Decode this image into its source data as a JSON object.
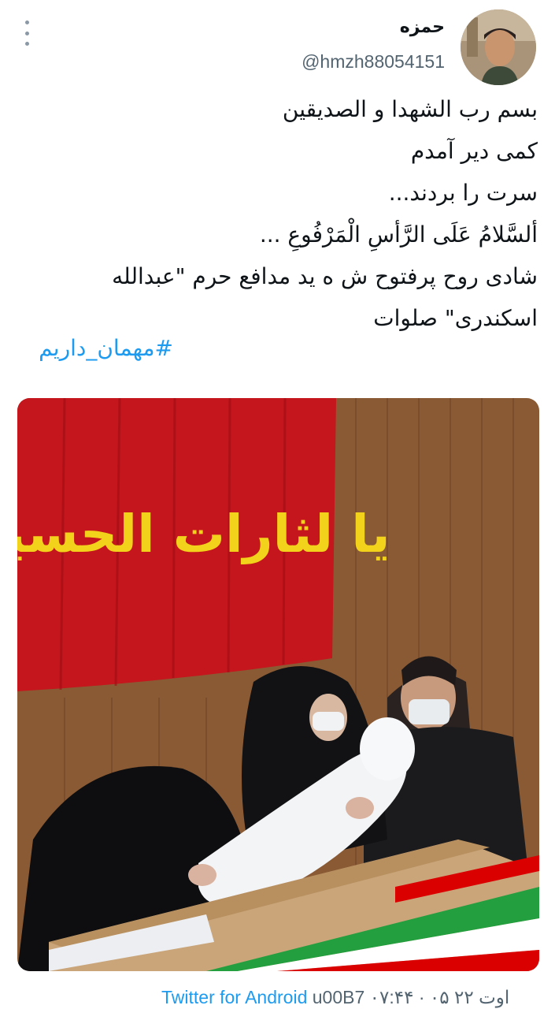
{
  "author": {
    "display_name": "حمزه",
    "handle": "@hmzh88054151",
    "avatar_icon": "user-avatar"
  },
  "tweet": {
    "lines": [
      "بسم رب الشهدا و الصدیقین",
      "کمی دیر آمدم",
      "سرت را بردند...",
      "ألسَّلامُ عَلَی الرَّأسِ الْمَرْفُوعِ ...",
      "شادی روح پرفتوح ش ه ید مدافع حرم \"عبدالله",
      "اسکندری\" صلوات"
    ],
    "hashtag": "#مهمان_داریم"
  },
  "photo": {
    "banner_text": "یا لثارات الحسین",
    "alt": "tweet-photo"
  },
  "footer": {
    "time_date": "۰۷:۴۴ · ۰۵ اوت ۲۲",
    "separator": "u00B7",
    "source": "Twitter for Android"
  },
  "colors": {
    "link": "#1d9bf0",
    "secondary_text": "#536471",
    "banner_red": "#c4161c",
    "banner_gold": "#f2d21a"
  }
}
